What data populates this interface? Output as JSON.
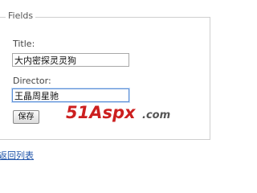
{
  "fieldset": {
    "legend": "Fields"
  },
  "form": {
    "title_label": "Title:",
    "title_value": "大内密探灵灵狗",
    "director_label": "Director:",
    "director_value": "王晶周星驰",
    "save_label": "保存"
  },
  "footer": {
    "back_link": "返回列表"
  },
  "watermark": {
    "text_main": "51Aspx",
    "text_suffix": ".com",
    "color_primary": "#cc1f1f",
    "color_secondary": "#555555"
  }
}
